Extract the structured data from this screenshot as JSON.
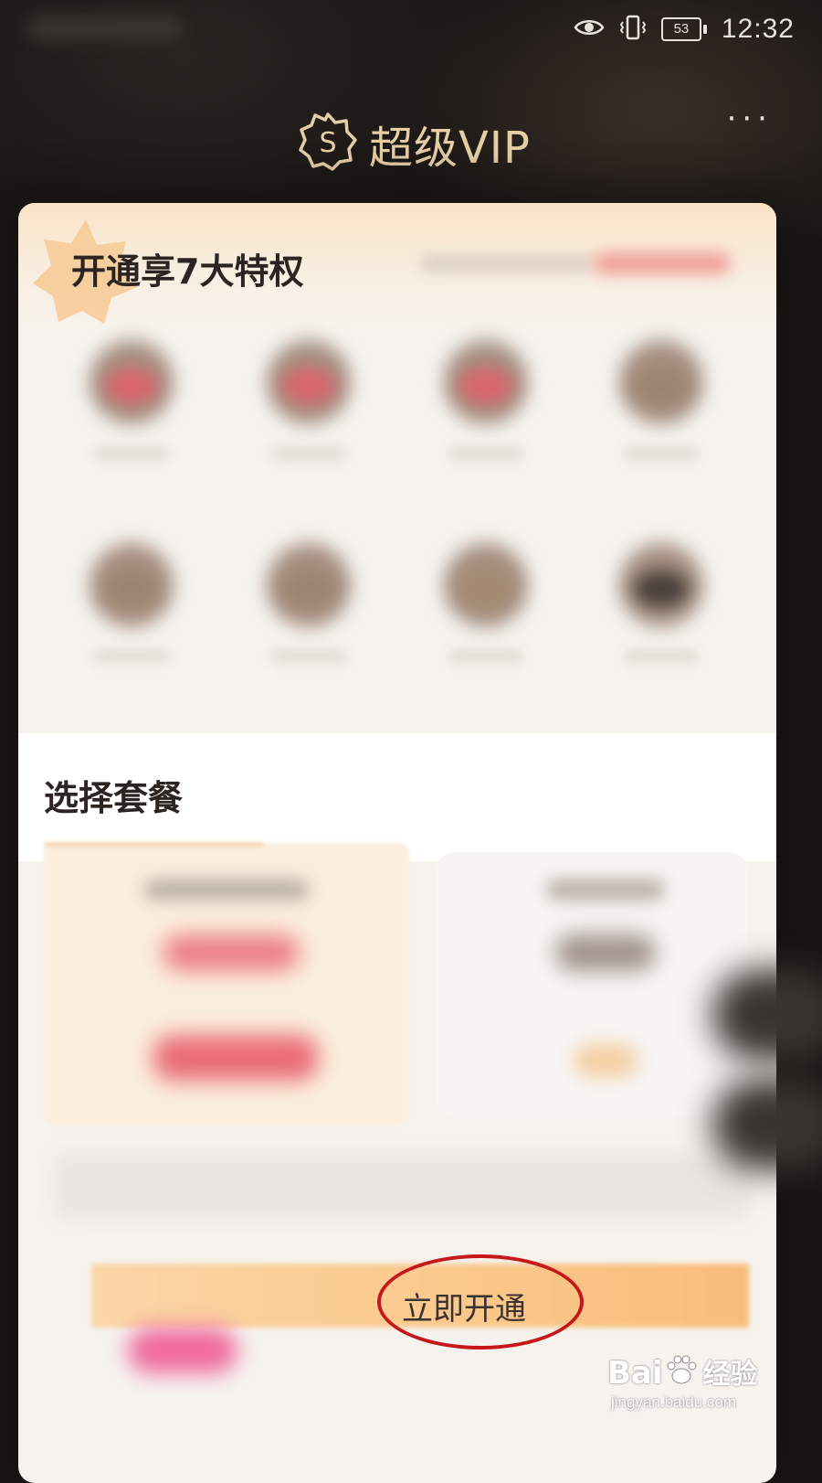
{
  "status_bar": {
    "battery": "53",
    "time": "12:32",
    "icons": [
      "eye-icon",
      "vibrate-icon",
      "battery-icon"
    ]
  },
  "header": {
    "logo_letter": "S",
    "title": "超级VIP",
    "more_icon": "more-dots-icon"
  },
  "privileges": {
    "title": "开通享7大特权",
    "items": [
      {
        "color": "#d9656d"
      },
      {
        "color": "#d9656d"
      },
      {
        "color": "#d9656d"
      },
      {
        "color": "#9c8470"
      },
      {
        "color": "#9c8470"
      },
      {
        "color": "#9c8470"
      },
      {
        "color": "#a48a70"
      },
      {
        "color": "#4a403b"
      }
    ]
  },
  "packages": {
    "title": "选择套餐"
  },
  "cta": {
    "label": "立即开通"
  },
  "watermark": {
    "brand_a": "Bai",
    "brand_b": "经验",
    "url": "jingyan.baidu.com"
  },
  "colors": {
    "gold": "#e6cfa4",
    "annotation_red": "#c6171b"
  }
}
